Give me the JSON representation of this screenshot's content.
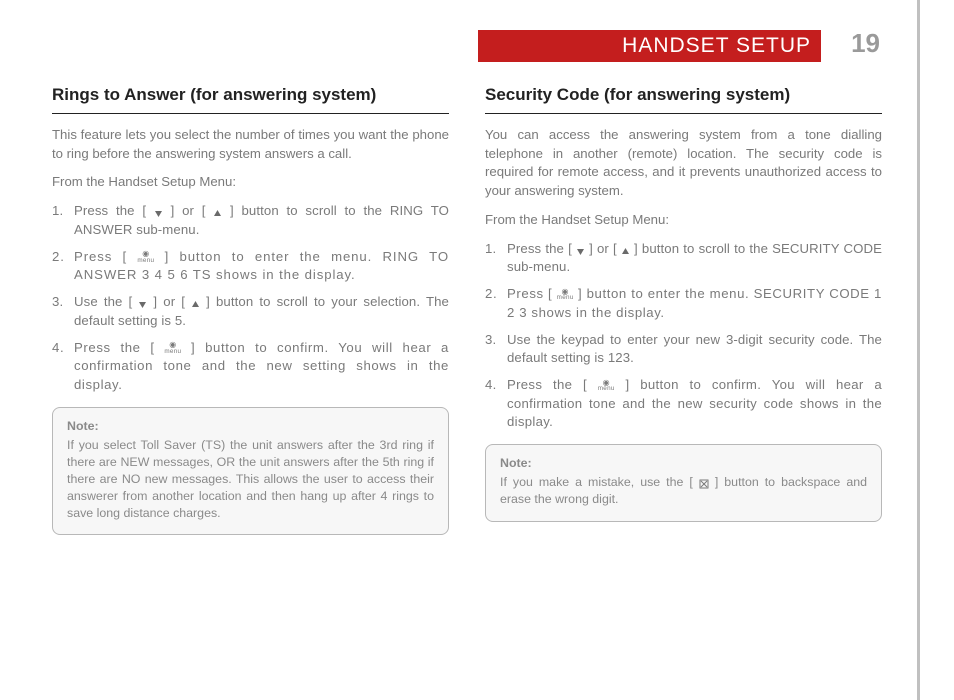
{
  "header": {
    "section_title": "HANDSET SETUP",
    "page_number": "19"
  },
  "left": {
    "heading": "Rings to Answer (for answering system)",
    "intro": "This feature lets you select the number of times you want the phone to ring before the answering system answers a call.",
    "from": "From the Handset Setup Menu:",
    "steps": [
      {
        "pre": "Press the [ ",
        "icon1": "down",
        "mid": " ] or [ ",
        "icon2": "up",
        "post": " ] button to scroll to the RING TO ANSWER sub-menu."
      },
      {
        "pre": "Press [ ",
        "icon1": "menu",
        "mid": "",
        "icon2": "",
        "post": " ] button to enter the menu. RING TO ANSWER 3 4 5 6 TS shows in the display."
      },
      {
        "pre": "Use the [ ",
        "icon1": "down",
        "mid": " ] or [ ",
        "icon2": "up",
        "post": " ] button to scroll to your selection. The default setting is 5."
      },
      {
        "pre": "Press the [ ",
        "icon1": "menu",
        "mid": "",
        "icon2": "",
        "post": " ] button to confirm. You will hear a confirmation tone and the new setting shows in the display."
      }
    ],
    "note_label": "Note:",
    "note_text": "If you select Toll Saver (TS) the unit answers after the 3rd ring if there are NEW messages, OR the unit answers after the 5th ring if there are NO new messages. This allows the user to access their answerer from another location and then hang up after 4 rings to save long distance charges."
  },
  "right": {
    "heading": "Security Code (for answering system)",
    "intro": "You can access the answering system from a tone dialling telephone in another (remote) location. The security code is required for remote access, and it prevents unauthorized access to your answering system.",
    "from": "From the Handset Setup Menu:",
    "steps": [
      {
        "pre": "Press the [ ",
        "icon1": "down",
        "mid": " ] or [ ",
        "icon2": "up",
        "post": " ] button to scroll to the SECURITY CODE sub-menu."
      },
      {
        "pre": "Press [ ",
        "icon1": "menu",
        "mid": "",
        "icon2": "",
        "post": " ] button to enter the menu. SECURITY CODE 1 2 3 shows in the display."
      },
      {
        "pre": "Use the keypad to enter your new 3-digit security code. The default setting is 123.",
        "icon1": "",
        "mid": "",
        "icon2": "",
        "post": ""
      },
      {
        "pre": "Press the [ ",
        "icon1": "menu",
        "mid": "",
        "icon2": "",
        "post": " ] button to confirm. You will hear a confirmation tone and the new security code shows in the display."
      }
    ],
    "note_label": "Note:",
    "note_pre": "If you make a mistake, use the [ ",
    "note_icon": "cancel",
    "note_post": " ] button to backspace and erase the wrong digit."
  },
  "icons": {
    "down": "▼",
    "up": "▲",
    "menu_top": "🎤",
    "menu_bottom": "menu",
    "cancel": "⊠"
  }
}
